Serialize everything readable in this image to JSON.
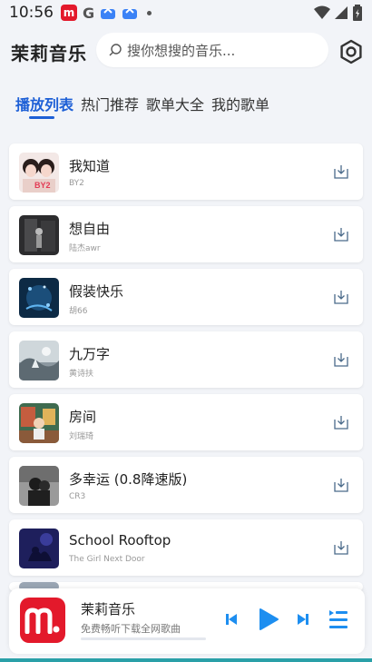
{
  "status_bar": {
    "time": "10:56",
    "app_icons": [
      "mi-music-icon",
      "google-icon",
      "cloud-icon",
      "cloud-icon"
    ]
  },
  "header": {
    "title": "茉莉音乐",
    "search_placeholder": "搜你想搜的音乐..."
  },
  "tabs": [
    {
      "label": "播放列表",
      "active": true
    },
    {
      "label": "热门推荐",
      "active": false
    },
    {
      "label": "歌单大全",
      "active": false
    },
    {
      "label": "我的歌单",
      "active": false
    }
  ],
  "songs": [
    {
      "title": "我知道",
      "artist": "BY2",
      "cover_label": "BY2"
    },
    {
      "title": "想自由",
      "artist": "陆杰awr"
    },
    {
      "title": "假装快乐",
      "artist": "胡66"
    },
    {
      "title": "九万字",
      "artist": "黄诗扶"
    },
    {
      "title": "房间",
      "artist": "刘瑞琦"
    },
    {
      "title": "多幸运 (0.8降速版)",
      "artist": "CR3"
    },
    {
      "title": "School Rooftop",
      "artist": "The Girl Next Door"
    }
  ],
  "player": {
    "title": "茉莉音乐",
    "subtitle": "免费畅听下载全网歌曲",
    "progress": 0
  },
  "colors": {
    "accent": "#1d5fd6",
    "player_accent": "#1d8ef0",
    "brand_red": "#e3192b"
  }
}
